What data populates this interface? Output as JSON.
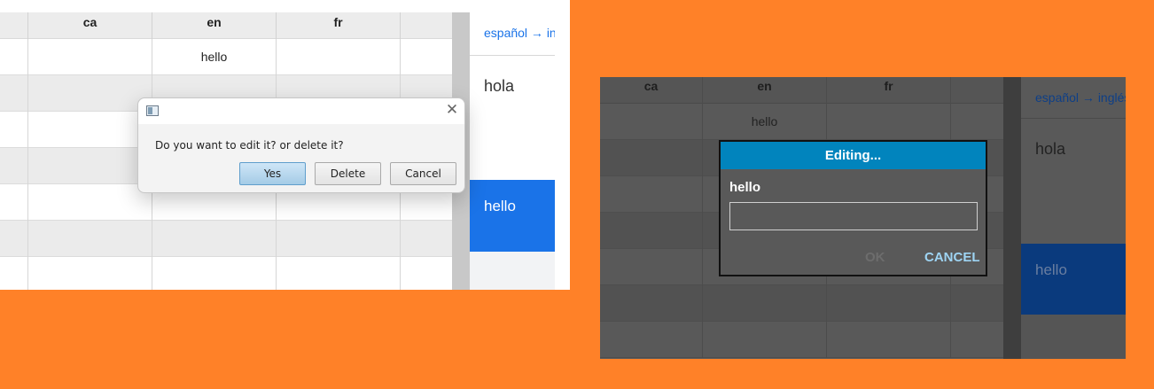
{
  "left_panel": {
    "columns": [
      "ca",
      "en",
      "fr"
    ],
    "row1": {
      "en": "hello"
    },
    "sidebar": {
      "header": "español → inglés",
      "card1": "hola",
      "card2": "hello"
    },
    "dialog": {
      "message": "Do you want to edit it? or delete it?",
      "yes_label": "Yes",
      "delete_label": "Delete",
      "cancel_label": "Cancel"
    }
  },
  "right_panel": {
    "columns": [
      "ca",
      "en",
      "fr"
    ],
    "row1": {
      "en": "hello"
    },
    "sidebar": {
      "header": "español → inglés",
      "card1": "hola",
      "card2": "hello"
    },
    "dialog": {
      "title": "Editing...",
      "field_label": "hello",
      "input_value": "",
      "ok_label": "OK",
      "cancel_label": "CANCEL"
    }
  },
  "colors": {
    "background": "#ff8128",
    "light_accent": "#1a73e8",
    "dark_titlebar": "#0184bd"
  }
}
